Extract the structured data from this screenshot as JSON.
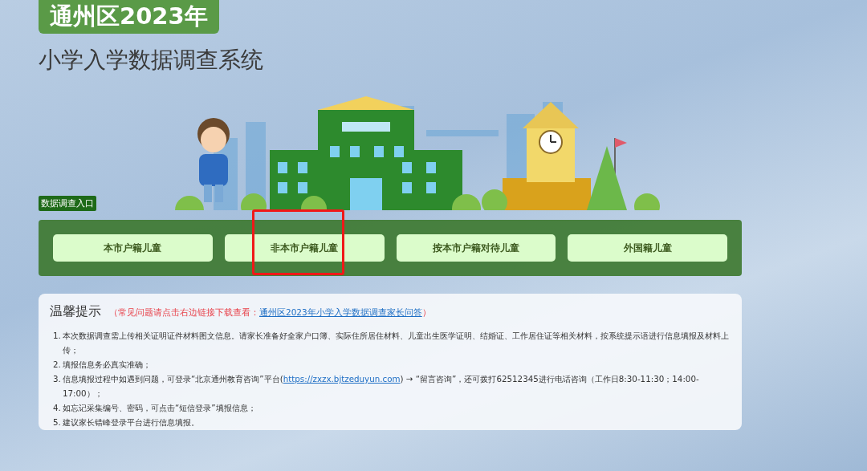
{
  "header": {
    "badge": "通州区2023年",
    "title": "小学入学数据调查系统"
  },
  "entry": {
    "label": "数据调查入口",
    "buttons": [
      {
        "label": "本市户籍儿童",
        "highlighted": false
      },
      {
        "label": "非本市户籍儿童",
        "highlighted": true
      },
      {
        "label": "按本市户籍对待儿童",
        "highlighted": false
      },
      {
        "label": "外国籍儿童",
        "highlighted": false
      }
    ]
  },
  "notice": {
    "title": "温馨提示",
    "note_before": "（常见问题请点击右边链接下载查看：",
    "note_link": "通州区2023年小学入学数据调查家长问答",
    "note_after": "）",
    "items": [
      {
        "number": "1.",
        "text": "本次数据调查需上传相关证明证件材料图文信息。请家长准备好全家户口簿、实际住所居住材料、儿童出生医学证明、结婚证、工作居住证等相关材料，按系统提示语进行信息填报及材料上传；"
      },
      {
        "number": "2.",
        "text": "填报信息务必真实准确；"
      },
      {
        "number": "3.",
        "text": "信息填报过程中如遇到问题，可登录“北京通州教育咨询”平台(",
        "link": "https://zxzx.bjtzeduyun.com",
        "text_after": ") → “留言咨询”，还可拨打62512345进行电话咨询（工作日8:30-11:30；14:00-17:00）；"
      },
      {
        "number": "4.",
        "text": "如忘记采集编号、密码，可点击“短信登录”填报信息；"
      },
      {
        "number": "5.",
        "text": "建议家长错峰登录平台进行信息填报。"
      }
    ]
  }
}
